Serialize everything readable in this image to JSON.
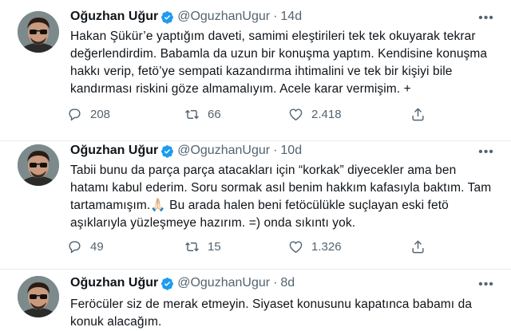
{
  "tweets": [
    {
      "name": "Oğuzhan Uğur",
      "handle": "@OguzhanUgur",
      "dot": "·",
      "time": "14d",
      "lines": [
        "Hakan Şükür’e yaptığım daveti, samimi eleştirileri tek tek okuyarak tekrar",
        "değerlendirdim. Babamla da uzun bir konuşma yaptım. Kendisine konuşma",
        "hakkı verip, fetö’ye sempati kazandırma ihtimalini ve tek bir kişiyi bile",
        "kandırması riskini göze almamalıyım. Acele karar vermişim. +"
      ],
      "replies": "208",
      "retweets": "66",
      "likes": "2.418"
    },
    {
      "name": "Oğuzhan Uğur",
      "handle": "@OguzhanUgur",
      "dot": "·",
      "time": "10d",
      "lines": [
        "Tabii bunu da parça parça atacakları için “korkak” diyecekler ama ben",
        "hatamı kabul ederim. Soru sormak asıl benim hakkım kafasıyla baktım. Tam",
        "tartamamışım.🙏🏻 Bu arada halen beni fetöcülükle suçlayan eski fetö",
        "aşıklarıyla yüzleşmeye hazırım. =) onda sıkıntı yok."
      ],
      "replies": "49",
      "retweets": "15",
      "likes": "1.326"
    },
    {
      "name": "Oğuzhan Uğur",
      "handle": "@OguzhanUgur",
      "dot": "·",
      "time": "8d",
      "lines": [
        "Feröcüler siz de merak etmeyin. Siyaset konusunu kapatınca babamı da",
        "konuk alacağım."
      ]
    }
  ],
  "icons": {
    "more": "more-icon",
    "verified": "verified-badge-icon",
    "reply": "reply-icon",
    "retweet": "retweet-icon",
    "like": "like-icon",
    "share": "share-icon"
  },
  "colors": {
    "verified": "#1d9bf0",
    "muted": "#536471",
    "text": "#0f1419",
    "divider": "#e6ecf0"
  }
}
